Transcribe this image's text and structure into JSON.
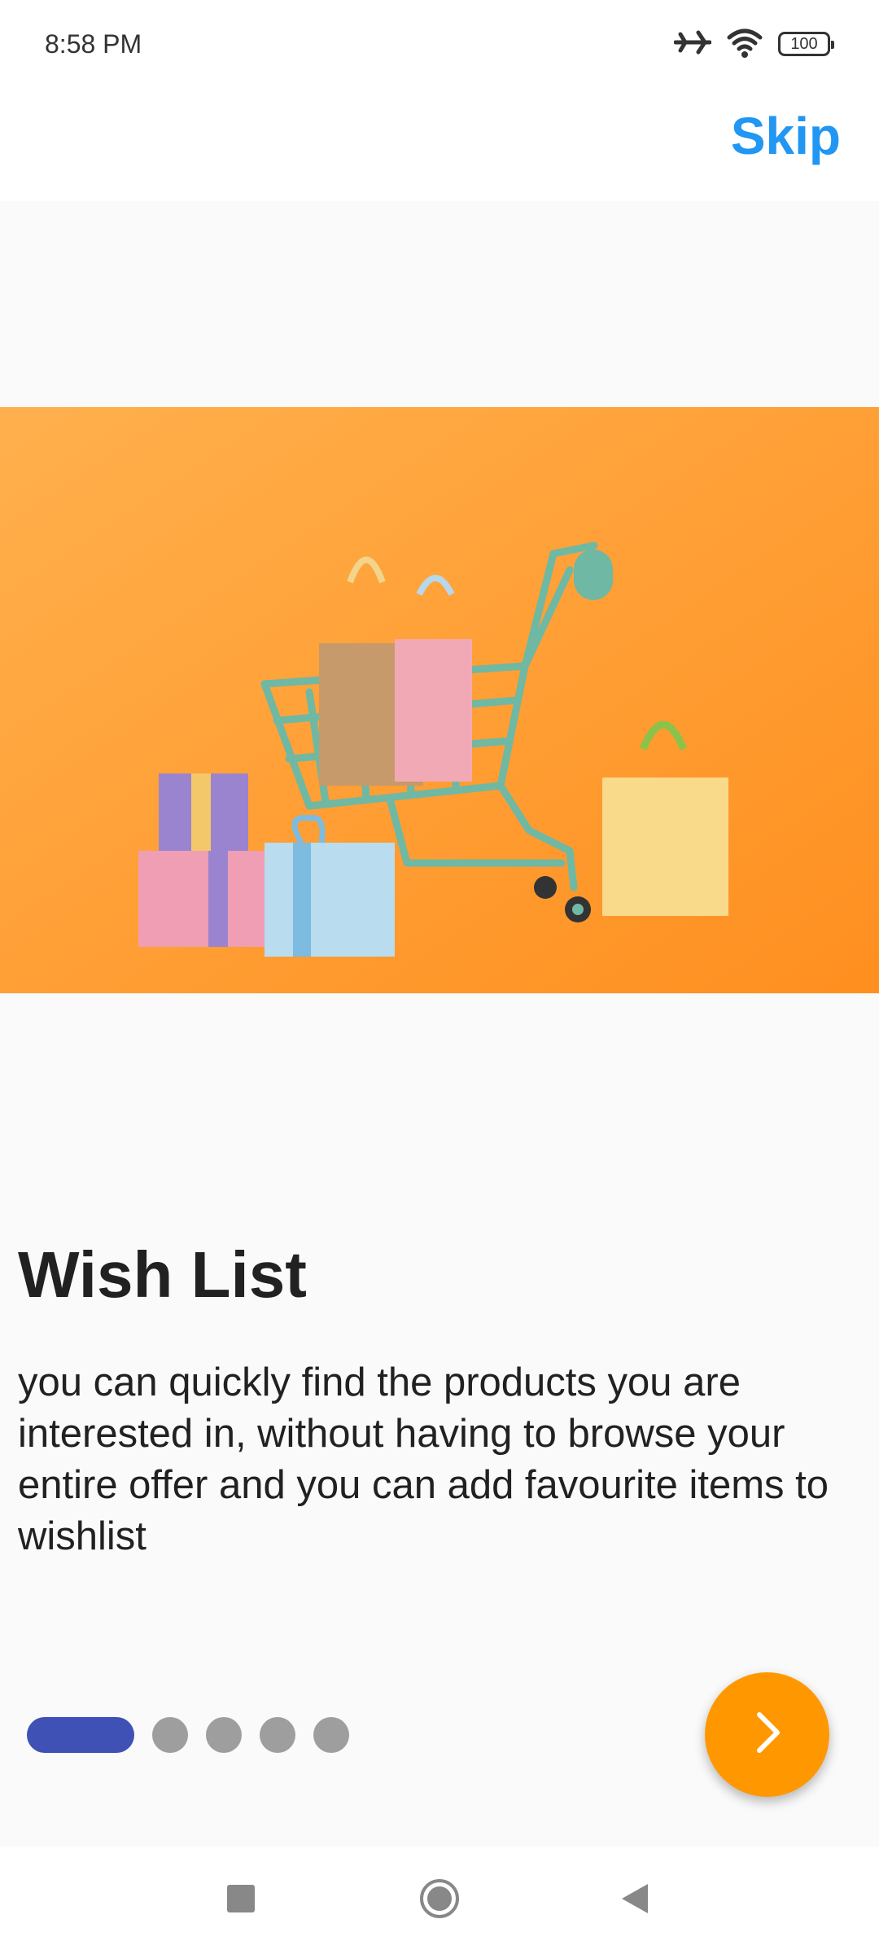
{
  "status_bar": {
    "time": "8:58 PM",
    "battery": "100",
    "icons": [
      "airplane-icon",
      "wifi-icon",
      "battery-icon"
    ]
  },
  "header": {
    "skip_label": "Skip"
  },
  "onboarding": {
    "title": "Wish List",
    "description": "you can quickly find the products you are interested in, without having to browse your entire offer and you can add favourite items to wishlist",
    "page_index": 1,
    "page_count": 5
  },
  "next_button": {
    "icon": "chevron-right-icon"
  },
  "nav_bar": {
    "icons": [
      "square-recents-icon",
      "circle-home-icon",
      "triangle-back-icon"
    ]
  },
  "colors": {
    "accent": "#2196f3",
    "fab": "#ff9800",
    "active_dot": "#3f51b5",
    "inactive_dot": "#9e9e9e",
    "hero_background": "#ffa23a"
  }
}
